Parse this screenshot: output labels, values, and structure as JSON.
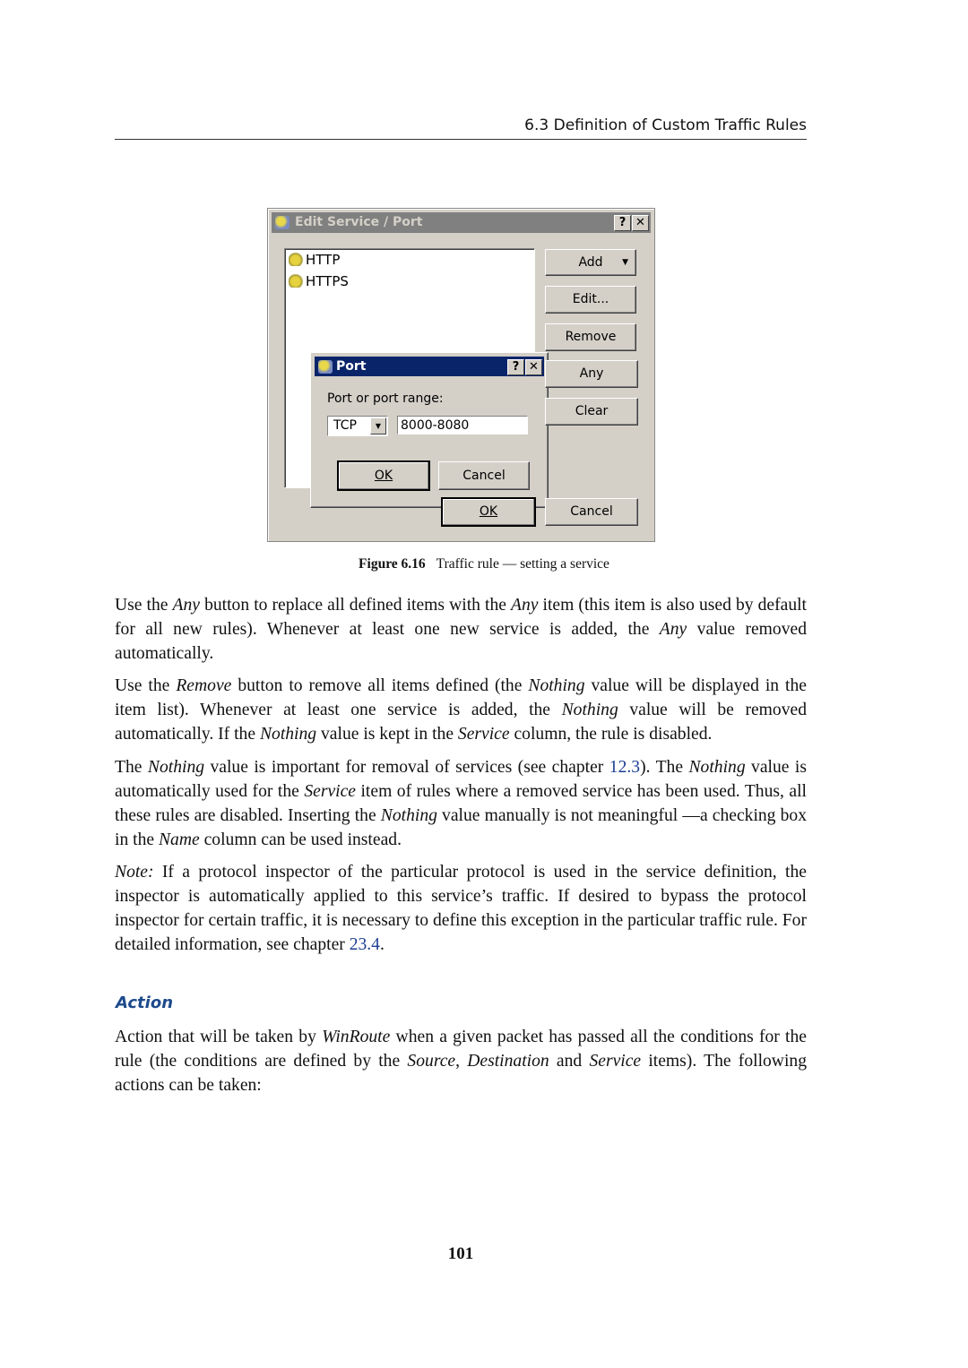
{
  "header": {
    "section": "6.3  Definition of Custom Traffic Rules"
  },
  "dialog": {
    "title": "Edit Service / Port",
    "help_label": "?",
    "close_label": "✕",
    "list_items": [
      {
        "label": "HTTP",
        "icon": "service-gear-icon"
      },
      {
        "label": "HTTPS",
        "icon": "service-gear-icon"
      }
    ],
    "buttons": {
      "add": "Add",
      "edit": "Edit...",
      "remove": "Remove",
      "any": "Any",
      "clear": "Clear",
      "ok": "OK",
      "cancel": "Cancel"
    },
    "port_dialog": {
      "title": "Port",
      "label": "Port or port range:",
      "protocol": "TCP",
      "range": "8000-8080",
      "ok": "OK",
      "cancel": "Cancel"
    }
  },
  "figure": {
    "number": "Figure 6.16",
    "caption": "Traffic rule — setting a service"
  },
  "paragraphs": [
    [
      {
        "t": "Use the "
      },
      {
        "t": "Any",
        "i": true
      },
      {
        "t": " button to replace all defined items with the "
      },
      {
        "t": "Any",
        "i": true
      },
      {
        "t": " item (this item is also used by default for all new rules). Whenever at least one new service is added, the "
      },
      {
        "t": "Any",
        "i": true
      },
      {
        "t": " value removed automatically."
      }
    ],
    [
      {
        "t": "Use the "
      },
      {
        "t": "Remove",
        "i": true
      },
      {
        "t": " button to remove all items defined (the "
      },
      {
        "t": "Nothing",
        "i": true
      },
      {
        "t": " value will be displayed in the item list). Whenever at least one service is added, the "
      },
      {
        "t": "Nothing",
        "i": true
      },
      {
        "t": " value will be removed automatically. If the "
      },
      {
        "t": "Nothing",
        "i": true
      },
      {
        "t": " value is kept in the "
      },
      {
        "t": "Service",
        "i": true
      },
      {
        "t": " column, the rule is disabled."
      }
    ],
    [
      {
        "t": "The "
      },
      {
        "t": "Nothing",
        "i": true
      },
      {
        "t": " value is important for removal of services (see chapter "
      },
      {
        "t": "12.3",
        "link": true
      },
      {
        "t": "). The "
      },
      {
        "t": "Nothing",
        "i": true
      },
      {
        "t": " value is automatically used for the "
      },
      {
        "t": "Service",
        "i": true
      },
      {
        "t": " item of rules where a removed service has been used. Thus, all these rules are disabled. Inserting the "
      },
      {
        "t": "Nothing",
        "i": true
      },
      {
        "t": " value manually is not meaningful —a checking box in the "
      },
      {
        "t": "Name",
        "i": true
      },
      {
        "t": " column can be used instead."
      }
    ],
    [
      {
        "t": "Note:",
        "i": true
      },
      {
        "t": " If a protocol inspector of the particular protocol is used in the service definition, the inspector is automatically applied to this service’s traffic. If desired to bypass the protocol inspector for certain traffic, it is necessary to define this exception in the par­ticular traffic rule. For detailed information, see chapter "
      },
      {
        "t": "23.4",
        "link": true
      },
      {
        "t": "."
      }
    ],
    [
      {
        "t": "Action that will be taken by "
      },
      {
        "t": "WinRoute",
        "i": true
      },
      {
        "t": " when a given packet has passed all the conditions for the rule (the conditions are defined by the "
      },
      {
        "t": "Source",
        "i": true
      },
      {
        "t": ", "
      },
      {
        "t": "Destination",
        "i": true
      },
      {
        "t": " and "
      },
      {
        "t": "Service",
        "i": true
      },
      {
        "t": " items). The following actions can be taken:"
      }
    ]
  ],
  "section_heading": "Action",
  "page_number": "101",
  "colors": {
    "link": "#1d3f93",
    "heading": "#1d4a8c",
    "active_title": "#0a246a",
    "inactive_title": "#808080"
  }
}
